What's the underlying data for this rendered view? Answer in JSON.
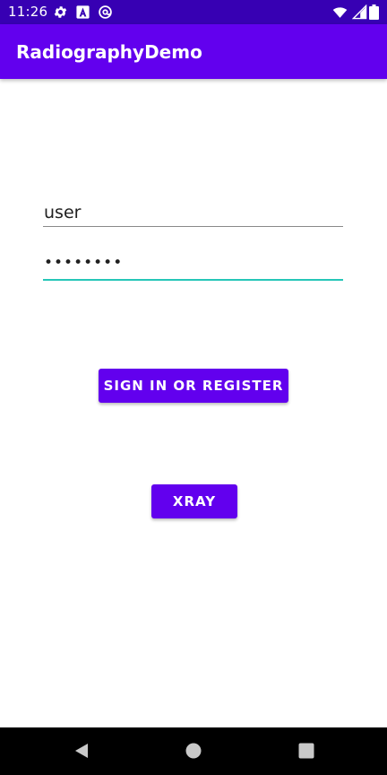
{
  "status_bar": {
    "time": "11:26",
    "icons": [
      "gear-icon",
      "font-a-icon",
      "at-sign-icon"
    ],
    "right_icons": [
      "wifi-icon",
      "signal-icon",
      "battery-icon"
    ]
  },
  "app_bar": {
    "title": "RadiographyDemo"
  },
  "form": {
    "username_value": "user",
    "password_value": "••••••••"
  },
  "buttons": {
    "signin_label": "SIGN IN OR REGISTER",
    "xray_label": "XRAY"
  },
  "nav_bar": {
    "icons": [
      "back-icon",
      "home-icon",
      "recents-icon"
    ]
  },
  "colors": {
    "status_bar": "#3700B3",
    "primary": "#6200EE",
    "focus_accent": "#26C6B8",
    "background": "#FFFFFF",
    "nav_bar": "#000000"
  }
}
